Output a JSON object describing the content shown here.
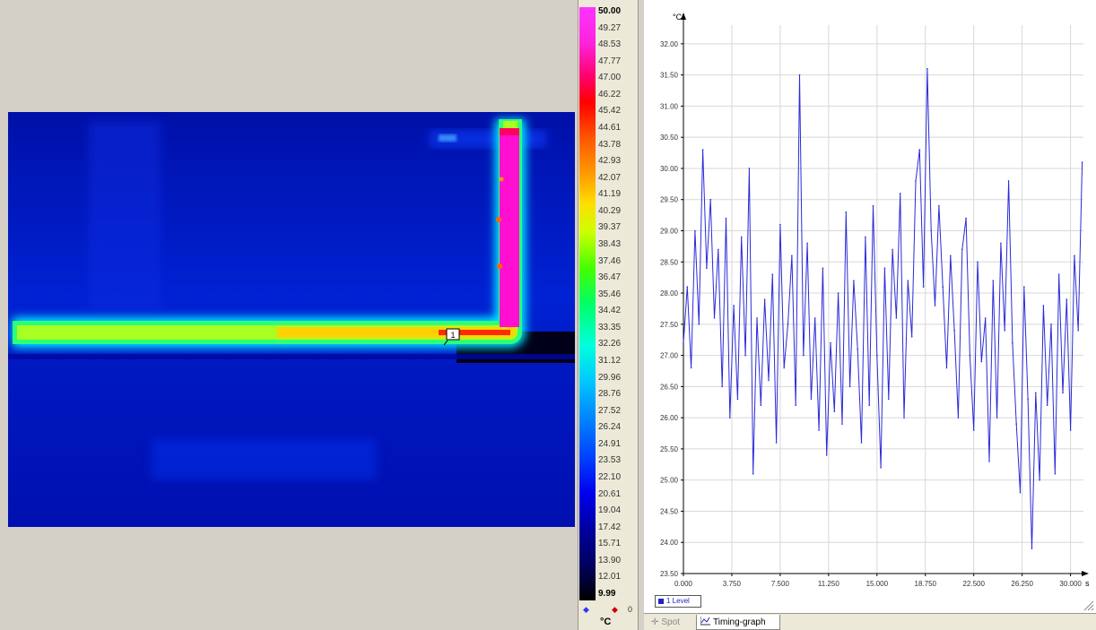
{
  "colorbar": {
    "labels": [
      "50.00",
      "49.27",
      "48.53",
      "47.77",
      "47.00",
      "46.22",
      "45.42",
      "44.61",
      "43.78",
      "42.93",
      "42.07",
      "41.19",
      "40.29",
      "39.37",
      "38.43",
      "37.46",
      "36.47",
      "35.46",
      "34.42",
      "33.35",
      "32.26",
      "31.12",
      "29.96",
      "28.76",
      "27.52",
      "26.24",
      "24.91",
      "23.53",
      "22.10",
      "20.61",
      "19.04",
      "17.42",
      "15.71",
      "13.90",
      "12.01",
      "9.99"
    ],
    "unit": "°C",
    "foot_value": "0"
  },
  "image": {
    "spot_marker": "1",
    "colors": {
      "background_hot": "#0018b8",
      "pipe_core": "#ff10d0"
    }
  },
  "graph": {
    "y_unit": "°C",
    "x_unit": "s",
    "legend_label": "1 Level",
    "colors": {
      "line": "#2a2ad8",
      "grid": "#d8d8d8"
    }
  },
  "tabs": [
    {
      "label": "Spot",
      "icon": "crosshair-icon"
    },
    {
      "label": "Timing-graph",
      "icon": "line-graph-icon"
    }
  ],
  "chart_data": {
    "type": "line",
    "xlim": [
      0,
      31.0
    ],
    "ylim": [
      23.5,
      32.3
    ],
    "yticks": [
      "32.00",
      "31.50",
      "31.00",
      "30.50",
      "30.00",
      "29.50",
      "29.00",
      "28.50",
      "28.00",
      "27.50",
      "27.00",
      "26.50",
      "26.00",
      "25.50",
      "25.00",
      "24.50",
      "24.00",
      "23.50"
    ],
    "xticks": [
      "0.000",
      "3.750",
      "7.500",
      "11.250",
      "15.000",
      "18.750",
      "22.500",
      "26.250",
      "30.000"
    ],
    "grid": true,
    "series": [
      {
        "name": "1 Level",
        "x": [
          0.0,
          0.3,
          0.6,
          0.9,
          1.2,
          1.5,
          1.8,
          2.1,
          2.4,
          2.7,
          3.0,
          3.3,
          3.6,
          3.9,
          4.2,
          4.5,
          4.8,
          5.1,
          5.4,
          5.7,
          6.0,
          6.3,
          6.6,
          6.9,
          7.2,
          7.5,
          7.8,
          8.1,
          8.4,
          8.7,
          9.0,
          9.3,
          9.6,
          9.9,
          10.2,
          10.5,
          10.8,
          11.1,
          11.4,
          11.7,
          12.0,
          12.3,
          12.6,
          12.9,
          13.2,
          13.5,
          13.8,
          14.1,
          14.4,
          14.7,
          15.0,
          15.3,
          15.6,
          15.9,
          16.2,
          16.5,
          16.8,
          17.1,
          17.4,
          17.7,
          18.0,
          18.3,
          18.6,
          18.9,
          19.2,
          19.5,
          19.8,
          20.1,
          20.4,
          20.7,
          21.0,
          21.3,
          21.6,
          21.9,
          22.2,
          22.5,
          22.8,
          23.1,
          23.4,
          23.7,
          24.0,
          24.3,
          24.6,
          24.9,
          25.2,
          25.5,
          25.8,
          26.1,
          26.4,
          26.7,
          27.0,
          27.3,
          27.6,
          27.9,
          28.2,
          28.5,
          28.8,
          29.1,
          29.4,
          29.7,
          30.0,
          30.3,
          30.6,
          30.9
        ],
        "y": [
          27.2,
          28.1,
          26.8,
          29.0,
          27.5,
          30.3,
          28.4,
          29.5,
          27.6,
          28.7,
          26.5,
          29.2,
          26.0,
          27.8,
          26.3,
          28.9,
          27.0,
          30.0,
          25.1,
          27.6,
          26.2,
          27.9,
          26.6,
          28.3,
          25.6,
          29.1,
          26.8,
          27.5,
          28.6,
          26.2,
          31.5,
          27.0,
          28.8,
          26.3,
          27.6,
          25.8,
          28.4,
          25.4,
          27.2,
          26.1,
          28.0,
          25.9,
          29.3,
          26.5,
          28.2,
          27.1,
          25.6,
          28.9,
          26.2,
          29.4,
          27.0,
          25.2,
          28.4,
          26.3,
          28.7,
          27.6,
          29.6,
          26.0,
          28.2,
          27.3,
          29.8,
          30.3,
          28.1,
          31.6,
          29.0,
          27.8,
          29.4,
          28.1,
          26.8,
          28.6,
          27.4,
          26.0,
          28.7,
          29.2,
          27.0,
          25.8,
          28.5,
          26.9,
          27.6,
          25.3,
          28.2,
          26.0,
          28.8,
          27.4,
          29.8,
          27.2,
          25.9,
          24.8,
          28.1,
          26.3,
          23.9,
          26.4,
          25.0,
          27.8,
          26.2,
          27.5,
          25.1,
          28.3,
          26.4,
          27.9,
          25.8,
          28.6,
          27.4,
          30.1
        ]
      }
    ]
  }
}
